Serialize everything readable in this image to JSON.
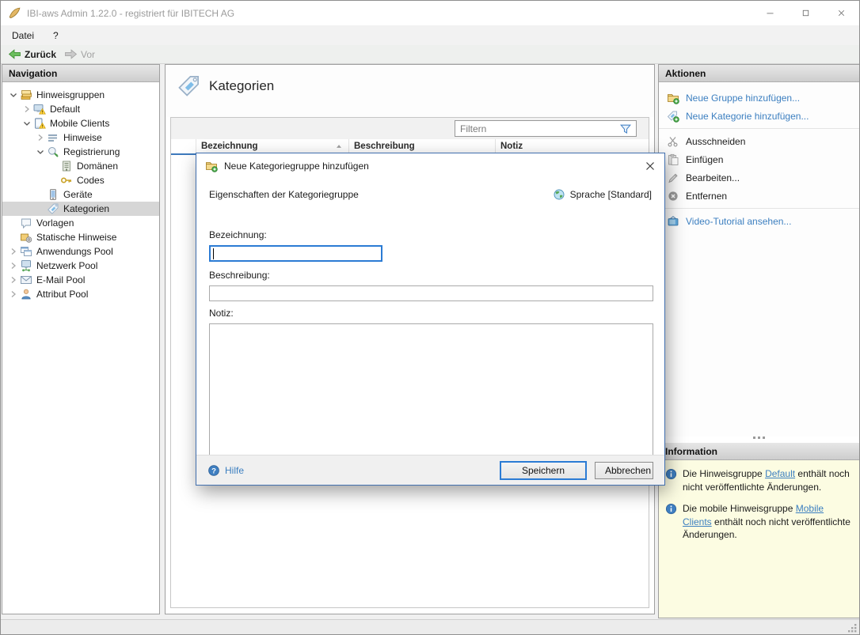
{
  "window": {
    "title": "IBI-aws Admin 1.22.0 - registriert für IBITECH AG",
    "app_icon": "app-icon",
    "controls": {
      "minimize": "minimize-icon",
      "maximize": "maximize-icon",
      "close": "close-icon"
    }
  },
  "menubar": {
    "items": [
      {
        "label": "Datei"
      },
      {
        "label": "?"
      }
    ]
  },
  "toolbar": {
    "back": {
      "label": "Zurück",
      "icon": "back-icon",
      "enabled": true
    },
    "forward": {
      "label": "Vor",
      "icon": "forward-icon",
      "enabled": false
    }
  },
  "navigation": {
    "header": "Navigation",
    "tree": [
      {
        "label": "Hinweisgruppen",
        "icon": "notice-groups-icon",
        "level": 0,
        "expander": "expanded",
        "selected": false
      },
      {
        "label": "Default",
        "icon": "monitor-warning-icon",
        "level": 1,
        "expander": "collapsed",
        "selected": false
      },
      {
        "label": "Mobile Clients",
        "icon": "mobile-warning-icon",
        "level": 1,
        "expander": "expanded",
        "selected": false
      },
      {
        "label": "Hinweise",
        "icon": "notes-icon",
        "level": 2,
        "expander": "collapsed",
        "selected": false
      },
      {
        "label": "Registrierung",
        "icon": "registration-icon",
        "level": 2,
        "expander": "expanded",
        "selected": false
      },
      {
        "label": "Domänen",
        "icon": "domain-icon",
        "level": 3,
        "expander": "none",
        "selected": false
      },
      {
        "label": "Codes",
        "icon": "key-icon",
        "level": 3,
        "expander": "none",
        "selected": false
      },
      {
        "label": "Geräte",
        "icon": "device-icon",
        "level": 2,
        "expander": "none",
        "selected": false
      },
      {
        "label": "Kategorien",
        "icon": "tag-icon",
        "level": 2,
        "expander": "none",
        "selected": true
      },
      {
        "label": "Vorlagen",
        "icon": "template-icon",
        "level": 0,
        "expander": "none",
        "selected": false
      },
      {
        "label": "Statische Hinweise",
        "icon": "static-notices-icon",
        "level": 0,
        "expander": "none",
        "selected": false
      },
      {
        "label": "Anwendungs Pool",
        "icon": "app-pool-icon",
        "level": 0,
        "expander": "collapsed",
        "selected": false
      },
      {
        "label": "Netzwerk Pool",
        "icon": "network-pool-icon",
        "level": 0,
        "expander": "collapsed",
        "selected": false
      },
      {
        "label": "E-Mail Pool",
        "icon": "email-pool-icon",
        "level": 0,
        "expander": "collapsed",
        "selected": false
      },
      {
        "label": "Attribut Pool",
        "icon": "attribute-pool-icon",
        "level": 0,
        "expander": "collapsed",
        "selected": false
      }
    ]
  },
  "main": {
    "title": "Kategorien",
    "title_icon": "tag-icon",
    "filter": {
      "placeholder": "Filtern",
      "icon": "filter-icon"
    },
    "table": {
      "columns": [
        {
          "label": "Bezeichnung",
          "sort": "asc"
        },
        {
          "label": "Beschreibung",
          "sort": null
        },
        {
          "label": "Notiz",
          "sort": null
        }
      ],
      "rows": []
    }
  },
  "actions": {
    "header": "Aktionen",
    "items": [
      {
        "label": "Neue Gruppe hinzufügen...",
        "icon": "add-group-icon",
        "style": "link"
      },
      {
        "label": "Neue Kategorie hinzufügen...",
        "icon": "add-category-icon",
        "style": "link"
      },
      {
        "divider": true
      },
      {
        "label": "Ausschneiden",
        "icon": "cut-icon",
        "style": "normal"
      },
      {
        "label": "Einfügen",
        "icon": "paste-icon",
        "style": "normal"
      },
      {
        "label": "Bearbeiten...",
        "icon": "edit-icon",
        "style": "normal"
      },
      {
        "label": "Entfernen",
        "icon": "remove-icon",
        "style": "normal"
      },
      {
        "divider": true
      },
      {
        "label": "Video-Tutorial ansehen...",
        "icon": "video-tutorial-icon",
        "style": "link"
      }
    ]
  },
  "information": {
    "header": "Information",
    "item_icon": "info-icon",
    "items": [
      {
        "parts": [
          {
            "text": "Die Hinweisgruppe "
          },
          {
            "text": "Default",
            "link": true
          },
          {
            "text": " enthält noch nicht veröffentlichte Änderungen."
          }
        ]
      },
      {
        "parts": [
          {
            "text": "Die mobile Hinweisgruppe "
          },
          {
            "text": "Mobile Clients",
            "link": true
          },
          {
            "text": " enthält noch nicht veröffentlichte Änderungen."
          }
        ]
      }
    ]
  },
  "dialog": {
    "title": "Neue Kategoriegruppe hinzufügen",
    "title_icon": "add-group-icon",
    "section_title": "Eigenschaften der Kategoriegruppe",
    "language": {
      "label": "Sprache [Standard]",
      "icon": "globe-icon"
    },
    "fields": {
      "bezeichnung": {
        "label": "Bezeichnung:",
        "value": "",
        "focused": true
      },
      "beschreibung": {
        "label": "Beschreibung:",
        "value": ""
      },
      "notiz": {
        "label": "Notiz:",
        "value": ""
      }
    },
    "help_label": "Hilfe",
    "help_icon": "help-icon",
    "save_label": "Speichern",
    "cancel_label": "Abbrechen"
  },
  "colors": {
    "accent": "#2b7bd4",
    "link": "#3c7fc0",
    "selection": "#d6d6d6",
    "info_bg": "#fcfce2",
    "table_header_line": "#3d79bc"
  }
}
